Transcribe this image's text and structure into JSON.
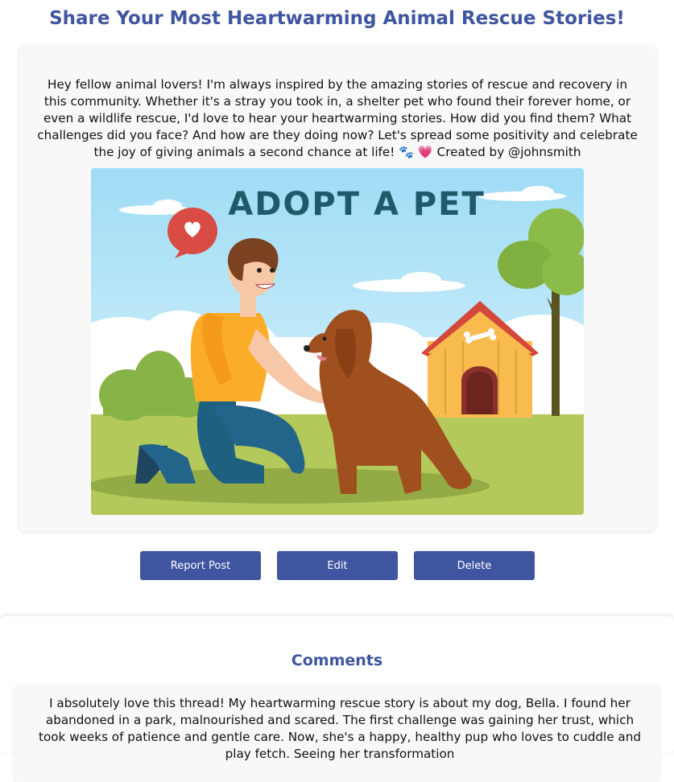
{
  "page": {
    "title": "Share Your Most Heartwarming Animal Rescue Stories!"
  },
  "post": {
    "body": "Hey fellow animal lovers! I'm always inspired by the amazing stories of rescue and recovery in this community. Whether it's a stray you took in, a shelter pet who found their forever home, or even a wildlife rescue, I'd love to hear your heartwarming stories. How did you find them? What challenges did you face? And how are they doing now? Let's spread some positivity and celebrate the joy of giving animals a second chance at life! 🐾 💗 Created by @johnsmith",
    "image": {
      "banner_text": "ADOPT A PET"
    }
  },
  "actions": {
    "report_label": "Report Post",
    "edit_label": "Edit",
    "delete_label": "Delete"
  },
  "comments": {
    "heading": "Comments",
    "items": [
      {
        "text": "I absolutely love this thread! My heartwarming rescue story is about my dog, Bella. I found her abandoned in a park, malnourished and scared. The first challenge was gaining her trust, which took weeks of patience and gentle care. Now, she's a happy, healthy pup who loves to cuddle and play fetch. Seeing her transformation"
      }
    ]
  },
  "colors": {
    "accent": "#3f55a0",
    "card_bg": "#f8f8f8"
  }
}
